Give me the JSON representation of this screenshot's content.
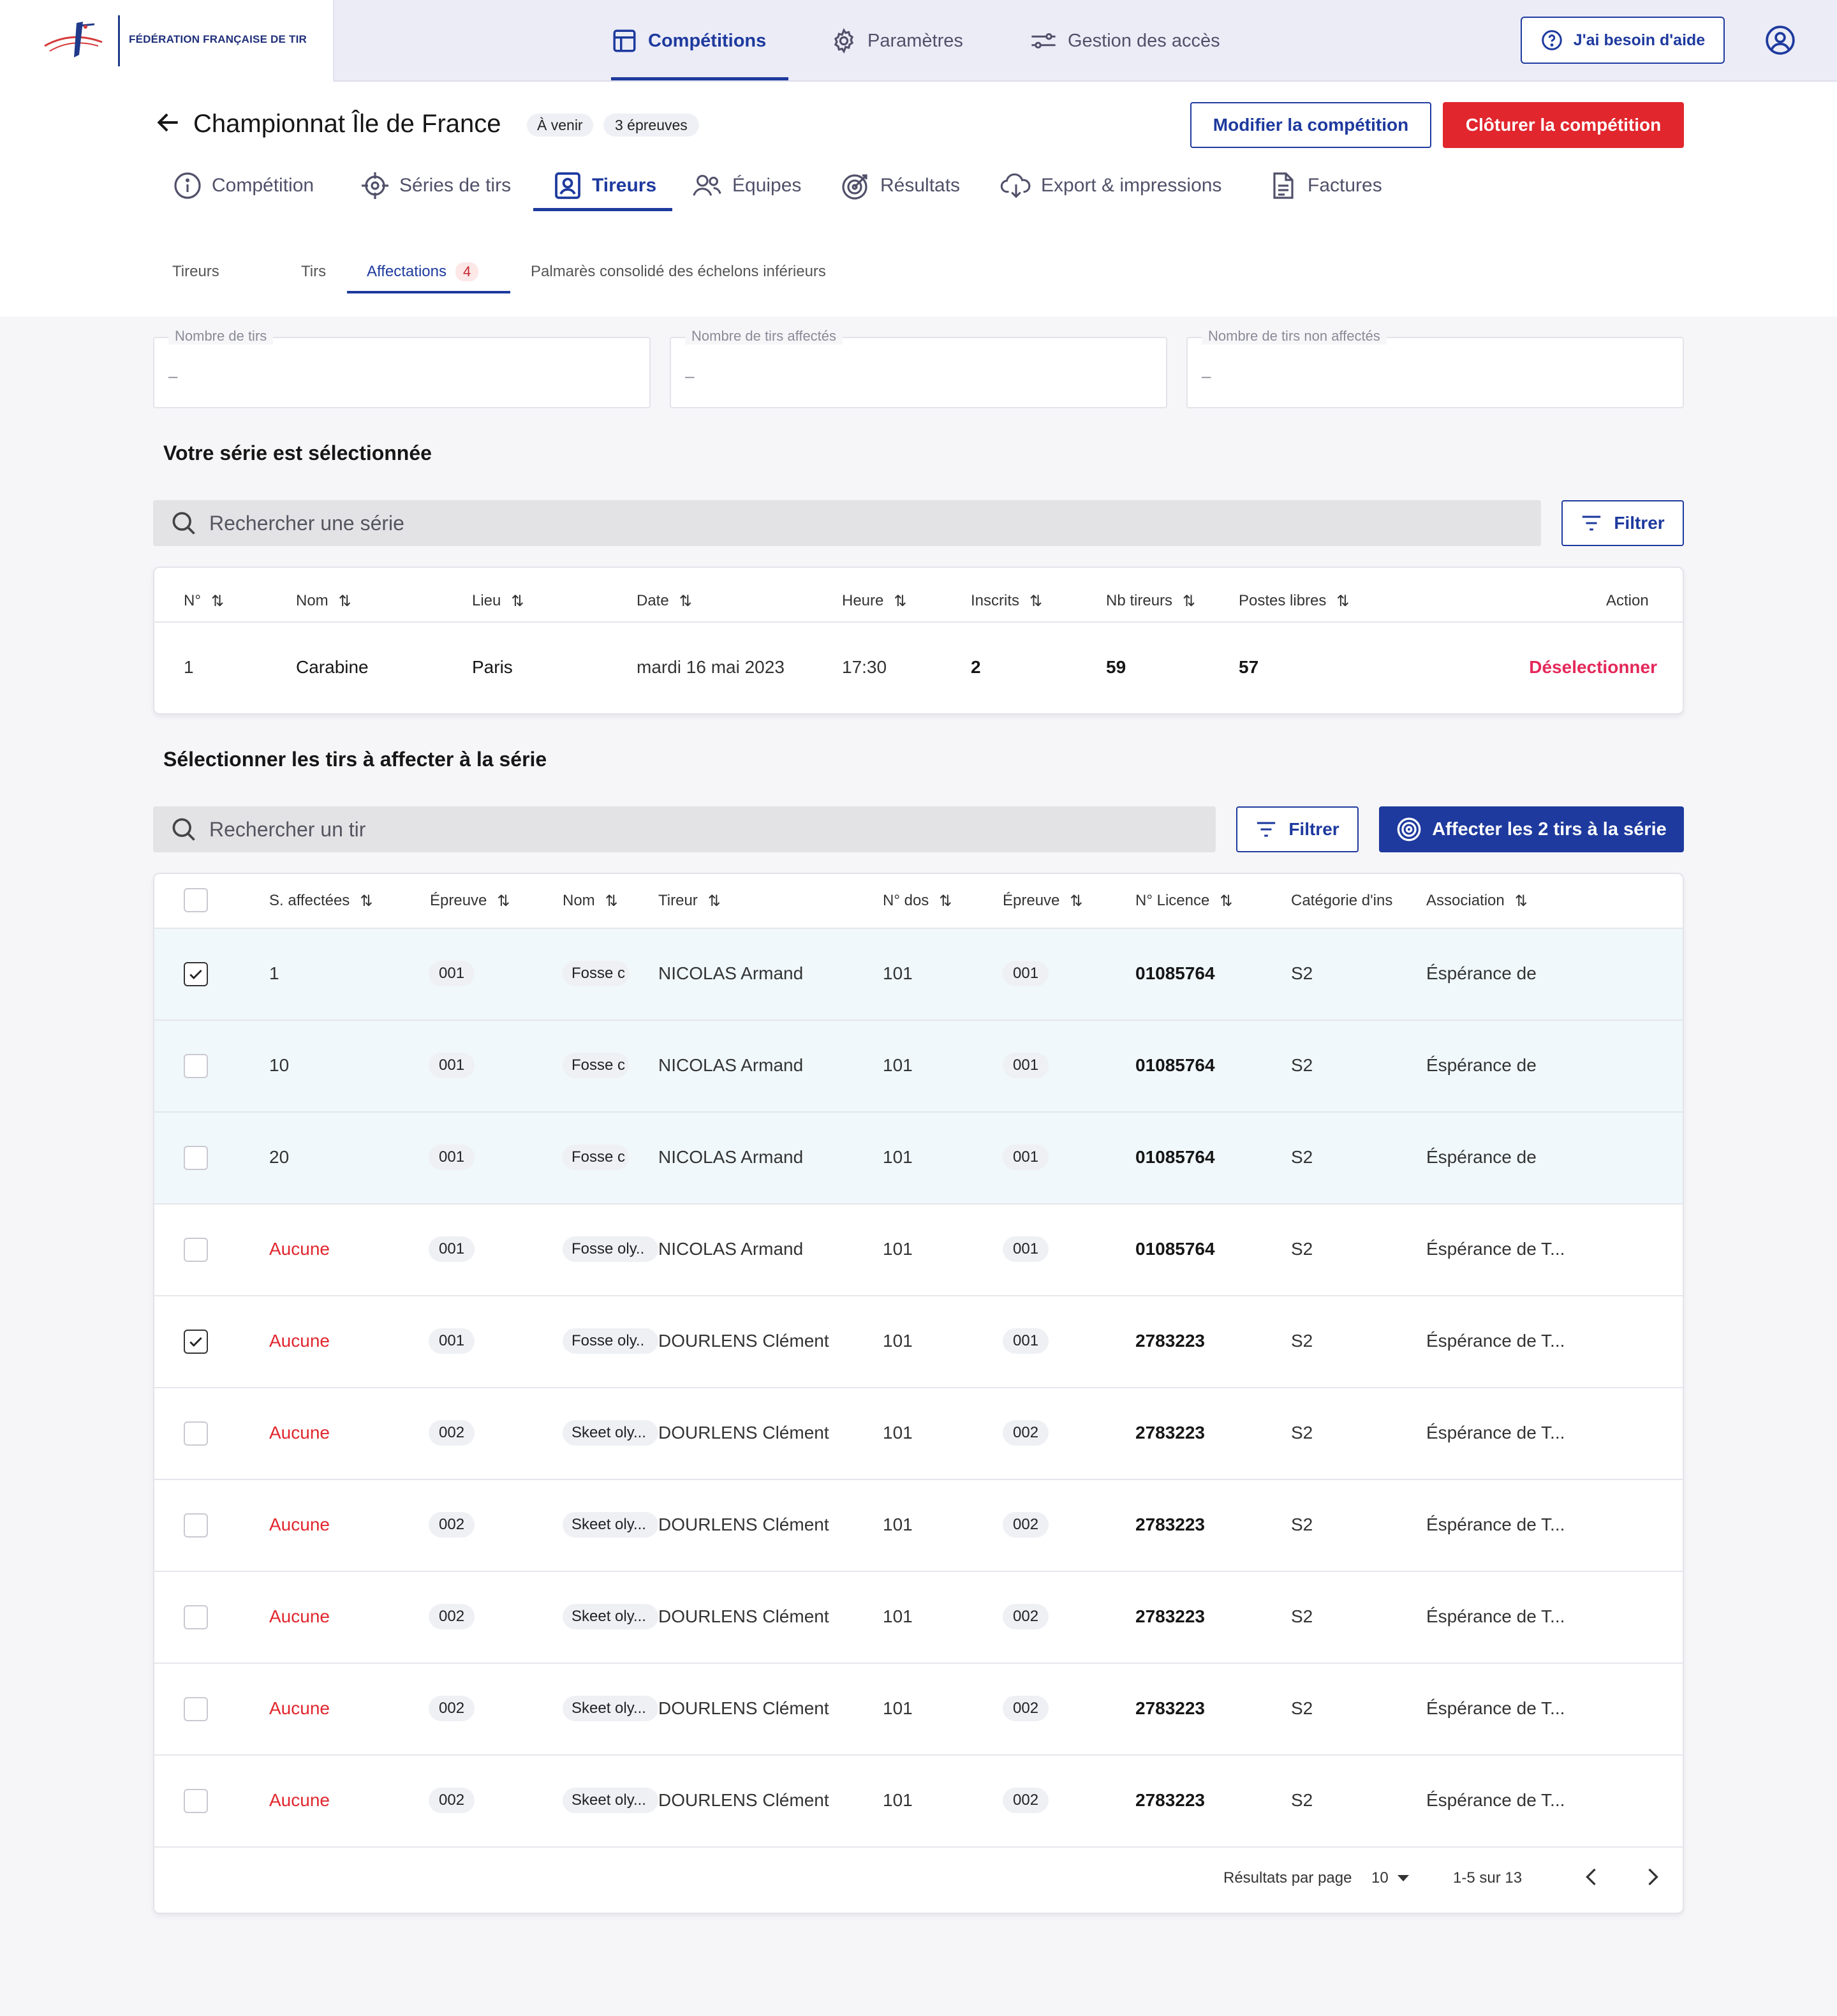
{
  "brand": {
    "name": "FÉDÉRATION FRANÇAISE DE TIR"
  },
  "topnav": [
    {
      "label": "Compétitions",
      "icon": "layout-icon"
    },
    {
      "label": "Paramètres",
      "icon": "gear-icon"
    },
    {
      "label": "Gestion des accès",
      "icon": "sliders-icon"
    }
  ],
  "help": {
    "label": "J'ai besoin d'aide"
  },
  "competition": {
    "title": "Championnat Île de France",
    "status": "À venir",
    "events": "3 épreuves",
    "modify_label": "Modifier la compétition",
    "close_label": "Clôturer la compétition"
  },
  "tabs": [
    {
      "label": "Compétition"
    },
    {
      "label": "Séries de tirs"
    },
    {
      "label": "Tireurs"
    },
    {
      "label": "Équipes"
    },
    {
      "label": "Résultats"
    },
    {
      "label": "Export & impressions"
    },
    {
      "label": "Factures"
    }
  ],
  "subtabs": [
    {
      "label": "Tireurs"
    },
    {
      "label": "Tirs"
    },
    {
      "label": "Affectations",
      "count": "4"
    },
    {
      "label": "Palmarès consolidé des échelons inférieurs"
    }
  ],
  "kpis": [
    {
      "label": "Nombre de tirs",
      "value": "–"
    },
    {
      "label": "Nombre de tirs affectés",
      "value": "–"
    },
    {
      "label": "Nombre de tirs non affectés",
      "value": "–"
    }
  ],
  "series_section": {
    "title": "Votre série est sélectionnée",
    "search_placeholder": "Rechercher une série",
    "filter_label": "Filtrer",
    "columns": [
      "N°",
      "Nom",
      "Lieu",
      "Date",
      "Heure",
      "Inscrits",
      "Nb tireurs",
      "Postes libres",
      "Action"
    ],
    "row": {
      "num": "1",
      "nom": "Carabine",
      "lieu": "Paris",
      "date": "mardi 16 mai 2023",
      "heure": "17:30",
      "inscrits": "2",
      "nb_tireurs": "59",
      "postes_libres": "57",
      "action": "Déselectionner"
    }
  },
  "tirs_section": {
    "title": "Sélectionner les tirs à affecter à la série",
    "search_placeholder": "Rechercher un tir",
    "filter_label": "Filtrer",
    "assign_label": "Affecter les 2 tirs à la série",
    "columns": [
      "S. affectées",
      "Épreuve",
      "Nom",
      "Tireur",
      "N° dos",
      "Épreuve",
      "N° Licence",
      "Catégorie d'ins",
      "Association"
    ],
    "rows": [
      {
        "checked": true,
        "highlight": true,
        "affectees": "1",
        "epreuve": "001",
        "nom": "Fosse c",
        "tireur": "NICOLAS Armand",
        "dos": "101",
        "epreuve2": "001",
        "licence": "01085764",
        "categorie": "S2",
        "association": "Éspérance de"
      },
      {
        "checked": false,
        "highlight": true,
        "affectees": "10",
        "epreuve": "001",
        "nom": "Fosse c",
        "tireur": "NICOLAS Armand",
        "dos": "101",
        "epreuve2": "001",
        "licence": "01085764",
        "categorie": "S2",
        "association": "Éspérance de"
      },
      {
        "checked": false,
        "highlight": true,
        "affectees": "20",
        "epreuve": "001",
        "nom": "Fosse c",
        "tireur": "NICOLAS Armand",
        "dos": "101",
        "epreuve2": "001",
        "licence": "01085764",
        "categorie": "S2",
        "association": "Éspérance de"
      },
      {
        "checked": false,
        "highlight": false,
        "affectees": "Aucune",
        "epreuve": "001",
        "nom": "Fosse oly..",
        "tireur": "NICOLAS Armand",
        "dos": "101",
        "epreuve2": "001",
        "licence": "01085764",
        "categorie": "S2",
        "association": "Éspérance de T..."
      },
      {
        "checked": true,
        "highlight": false,
        "affectees": "Aucune",
        "epreuve": "001",
        "nom": "Fosse oly..",
        "tireur": "DOURLENS Clément",
        "dos": "101",
        "epreuve2": "001",
        "licence": "2783223",
        "categorie": "S2",
        "association": "Éspérance de T..."
      },
      {
        "checked": false,
        "highlight": false,
        "affectees": "Aucune",
        "epreuve": "002",
        "nom": "Skeet oly...",
        "tireur": "DOURLENS Clément",
        "dos": "101",
        "epreuve2": "002",
        "licence": "2783223",
        "categorie": "S2",
        "association": "Éspérance de T..."
      },
      {
        "checked": false,
        "highlight": false,
        "affectees": "Aucune",
        "epreuve": "002",
        "nom": "Skeet oly...",
        "tireur": "DOURLENS Clément",
        "dos": "101",
        "epreuve2": "002",
        "licence": "2783223",
        "categorie": "S2",
        "association": "Éspérance de T..."
      },
      {
        "checked": false,
        "highlight": false,
        "affectees": "Aucune",
        "epreuve": "002",
        "nom": "Skeet oly...",
        "tireur": "DOURLENS Clément",
        "dos": "101",
        "epreuve2": "002",
        "licence": "2783223",
        "categorie": "S2",
        "association": "Éspérance de T..."
      },
      {
        "checked": false,
        "highlight": false,
        "affectees": "Aucune",
        "epreuve": "002",
        "nom": "Skeet oly...",
        "tireur": "DOURLENS Clément",
        "dos": "101",
        "epreuve2": "002",
        "licence": "2783223",
        "categorie": "S2",
        "association": "Éspérance de T..."
      },
      {
        "checked": false,
        "highlight": false,
        "affectees": "Aucune",
        "epreuve": "002",
        "nom": "Skeet oly...",
        "tireur": "DOURLENS Clément",
        "dos": "101",
        "epreuve2": "002",
        "licence": "2783223",
        "categorie": "S2",
        "association": "Éspérance de T..."
      }
    ],
    "pagination": {
      "per_page_label": "Résultats par page",
      "per_page": "10",
      "range": "1-5 sur 13"
    }
  },
  "colors": {
    "primary": "#1e3a9e",
    "danger": "#e1262d",
    "highlight_row": "#f0f8fc"
  }
}
